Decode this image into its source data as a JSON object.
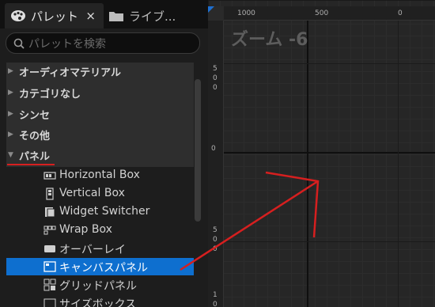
{
  "tabs": {
    "active_label": "パレット",
    "close_glyph": "×",
    "inactive_label": "ライブ..."
  },
  "search": {
    "placeholder": "パレットを検索"
  },
  "categories": [
    {
      "label": "オーディオマテリアル",
      "state": "collapsed"
    },
    {
      "label": "カテゴリなし",
      "state": "collapsed"
    },
    {
      "label": "シンセ",
      "state": "collapsed"
    },
    {
      "label": "その他",
      "state": "collapsed"
    },
    {
      "label": "パネル",
      "state": "expanded"
    }
  ],
  "items": [
    {
      "label": "Horizontal Box",
      "icon": "horizontal-box-icon"
    },
    {
      "label": "Vertical Box",
      "icon": "vertical-box-icon"
    },
    {
      "label": "Widget Switcher",
      "icon": "widget-switcher-icon"
    },
    {
      "label": "Wrap Box",
      "icon": "wrap-box-icon"
    },
    {
      "label": "オーバーレイ",
      "icon": "overlay-icon"
    },
    {
      "label": "キャンバスパネル",
      "icon": "canvas-panel-icon",
      "selected": true
    },
    {
      "label": "グリッドパネル",
      "icon": "grid-panel-icon"
    },
    {
      "label": "サイズボックス",
      "icon": "size-box-icon"
    }
  ],
  "canvas": {
    "zoom_label": "ズーム -6",
    "ruler_top": [
      "1000",
      "500",
      "0"
    ],
    "ruler_left": [
      "5",
      "0",
      "0",
      "5",
      "0",
      "0",
      "1",
      "0"
    ]
  },
  "colors": {
    "selection": "#0e6fcf",
    "annotation": "#d61f1f"
  }
}
